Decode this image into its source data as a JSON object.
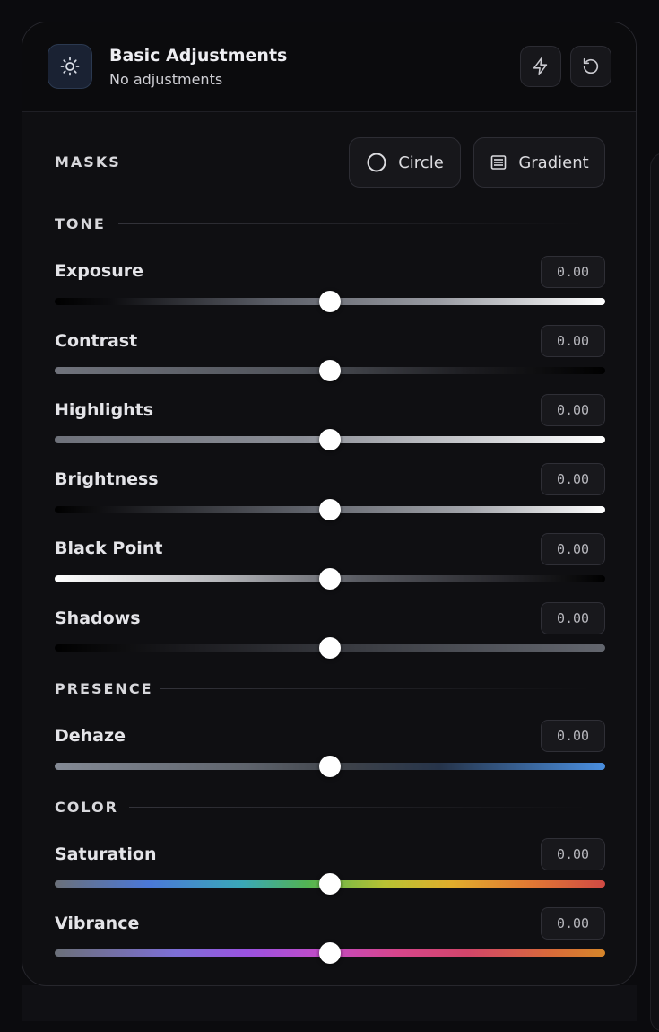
{
  "header": {
    "title": "Basic Adjustments",
    "subtitle": "No adjustments",
    "icon": "sun-icon",
    "actions": [
      {
        "name": "auto-adjust-button",
        "icon": "bolt-icon"
      },
      {
        "name": "reset-button",
        "icon": "reset-icon"
      }
    ]
  },
  "masks": {
    "label": "MASKS",
    "buttons": [
      {
        "label": "Circle",
        "icon": "circle-icon"
      },
      {
        "label": "Gradient",
        "icon": "gradient-list-icon"
      }
    ]
  },
  "sections": {
    "tone": "TONE",
    "presence": "PRESENCE",
    "color": "COLOR"
  },
  "controls": {
    "exposure": {
      "label": "Exposure",
      "value": "0.00",
      "position": 0.5
    },
    "contrast": {
      "label": "Contrast",
      "value": "0.00",
      "position": 0.5
    },
    "highlights": {
      "label": "Highlights",
      "value": "0.00",
      "position": 0.5
    },
    "brightness": {
      "label": "Brightness",
      "value": "0.00",
      "position": 0.5
    },
    "blackpoint": {
      "label": "Black Point",
      "value": "0.00",
      "position": 0.5
    },
    "shadows": {
      "label": "Shadows",
      "value": "0.00",
      "position": 0.5
    },
    "dehaze": {
      "label": "Dehaze",
      "value": "0.00",
      "position": 0.5
    },
    "saturation": {
      "label": "Saturation",
      "value": "0.00",
      "position": 0.5
    },
    "vibrance": {
      "label": "Vibrance",
      "value": "0.00",
      "position": 0.5
    }
  },
  "colors": {
    "accent": "#4a8fe0",
    "panel": "#0f0f12",
    "icon_tile": "#1a2233"
  }
}
